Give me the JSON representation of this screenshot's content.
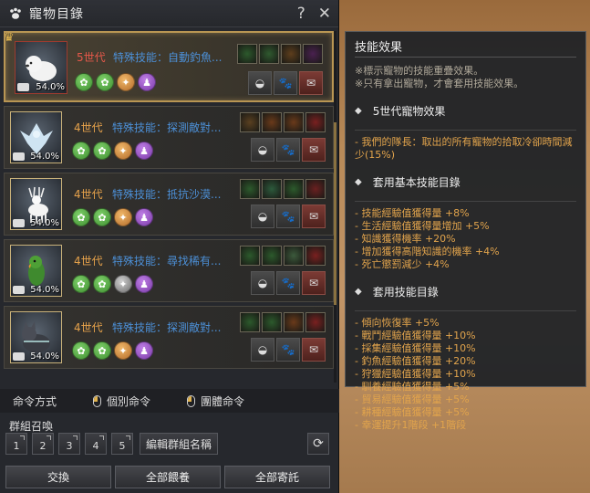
{
  "window": {
    "title": "寵物目錄",
    "help": "?",
    "close": "✕"
  },
  "pets": [
    {
      "generation": "5世代",
      "skill": "特殊技能：自動釣魚...",
      "pct": "54.0%",
      "selected": true,
      "traits": [
        "green",
        "green",
        "orange",
        "purple"
      ],
      "skills": [
        "#2c5a2c",
        "#2f5a2f",
        "#5e3e1c",
        "#4a2050"
      ]
    },
    {
      "generation": "4世代",
      "skill": "特殊技能：探測敵對...",
      "pct": "54.0%",
      "traits": [
        "green",
        "green",
        "orange",
        "purple"
      ],
      "skills": [
        "#5a4020",
        "#6a3a1a",
        "#6a3a1a",
        "#7a2020"
      ]
    },
    {
      "generation": "4世代",
      "skill": "特殊技能：抵抗沙漠...",
      "pct": "54.0%",
      "traits": [
        "green",
        "green",
        "orange",
        "purple"
      ],
      "skills": [
        "#2c5a2c",
        "#2c5a3c",
        "#2c5a2c",
        "#6a2020"
      ]
    },
    {
      "generation": "4世代",
      "skill": "特殊技能：尋找稀有...",
      "pct": "54.0%",
      "traits": [
        "green",
        "green",
        "gray",
        "purple"
      ],
      "skills": [
        "#2c5a2c",
        "#2c5a2c",
        "#3c5a3c",
        "#7a2020"
      ]
    },
    {
      "generation": "4世代",
      "skill": "特殊技能：探測敵對...",
      "pct": "54.0%",
      "traits": [
        "green",
        "green",
        "orange",
        "purple"
      ],
      "skills": [
        "#2c5a2c",
        "#2c5a2c",
        "#6a3a1a",
        "#7a2020"
      ]
    }
  ],
  "command": {
    "label": "命令方式",
    "individual": "個別命令",
    "group": "團體命令"
  },
  "group": {
    "label": "群組召喚",
    "buttons": [
      "1",
      "2",
      "3",
      "4",
      "5"
    ],
    "edit": "編輯群組名稱"
  },
  "bottom": {
    "exchange": "交換",
    "feed_all": "全部餵養",
    "deposit_all": "全部寄託"
  },
  "tooltip": {
    "title": "技能效果",
    "notes": [
      "※標示寵物的技能重疊效果。",
      "※只有拿出寵物，才會套用技能效果。"
    ],
    "sec1": "5世代寵物效果",
    "sec1_items": [
      "- 我們的隊長：取出的所有寵物的拾取冷卻時間減少(15%)"
    ],
    "sec2": "套用基本技能目錄",
    "sec2_items": [
      "- 技能經驗值獲得量 +8%",
      "- 生活經驗值獲得量增加 +5%",
      "- 知識獲得機率 +20%",
      "- 增加獲得高階知識的機率 +4%",
      "- 死亡懲罰減少 +4%"
    ],
    "sec3": "套用技能目錄",
    "sec3_items": [
      "- 傾向恢復率 +5%",
      "- 戰鬥經驗值獲得量 +10%",
      "- 採集經驗值獲得量 +10%",
      "- 釣魚經驗值獲得量 +20%",
      "- 狩獵經驗值獲得量 +10%",
      "- 馴養經驗值獲得量 +5%",
      "- 貿易經驗值獲得量 +5%",
      "- 耕種經驗值獲得量 +5%",
      "- 幸運提升1階段 +1階段"
    ]
  }
}
